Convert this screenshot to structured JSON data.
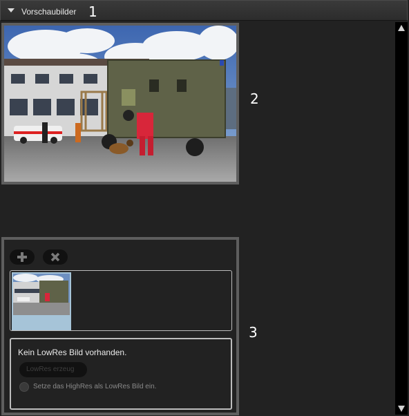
{
  "header": {
    "title": "Vorschaubilder",
    "icon": "chevron-down-icon"
  },
  "markers": {
    "m1": "1",
    "m2": "2",
    "m3": "3"
  },
  "lowres": {
    "message": "Kein LowRes Bild vorhanden.",
    "button_label": "LowRes erzeug",
    "radio_label": "Setze das HighRes als LowRes Bild ein."
  },
  "toolbar": {
    "add_icon": "plus-icon",
    "remove_icon": "close-icon"
  },
  "colors": {
    "background": "#222222",
    "frame": "#5e5e5e",
    "scrollbar": "#000000"
  }
}
